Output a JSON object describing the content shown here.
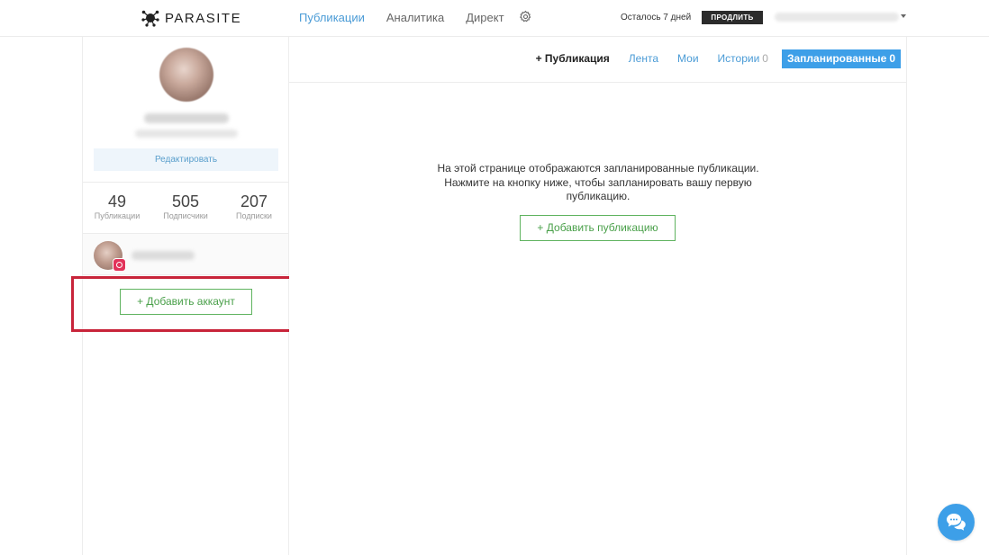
{
  "brand": {
    "name": "PARASITE"
  },
  "nav": {
    "items": [
      {
        "label": "Публикации",
        "active": true
      },
      {
        "label": "Аналитика",
        "active": false
      },
      {
        "label": "Директ",
        "active": false
      }
    ],
    "settings_icon": "gear-icon"
  },
  "account_bar": {
    "trial_text": "Осталось 7 дней",
    "extend_label": "ПРОДЛИТЬ"
  },
  "sidebar": {
    "edit_label": "Редактировать",
    "stats": [
      {
        "value": "49",
        "label": "Публикации"
      },
      {
        "value": "505",
        "label": "Подписчики"
      },
      {
        "value": "207",
        "label": "Подписки"
      }
    ],
    "add_account_label": "+ Добавить аккаунт"
  },
  "tabs": {
    "new_publication": "+ Публикация",
    "feed": "Лента",
    "mine": "Мои",
    "stories": {
      "label": "Истории",
      "count": "0"
    },
    "scheduled": {
      "label": "Запланированные",
      "count": "0"
    }
  },
  "main": {
    "empty_message": "На этой странице отображаются запланированные публикации. Нажмите на кнопку ниже, чтобы запланировать вашу первую публикацию.",
    "add_publication_label": "+ Добавить публикацию"
  },
  "colors": {
    "accent": "#3d9fe8",
    "link": "#4a9bd6",
    "success": "#4aa04a",
    "highlight": "#c8243a",
    "instagram": "#e2335a"
  }
}
